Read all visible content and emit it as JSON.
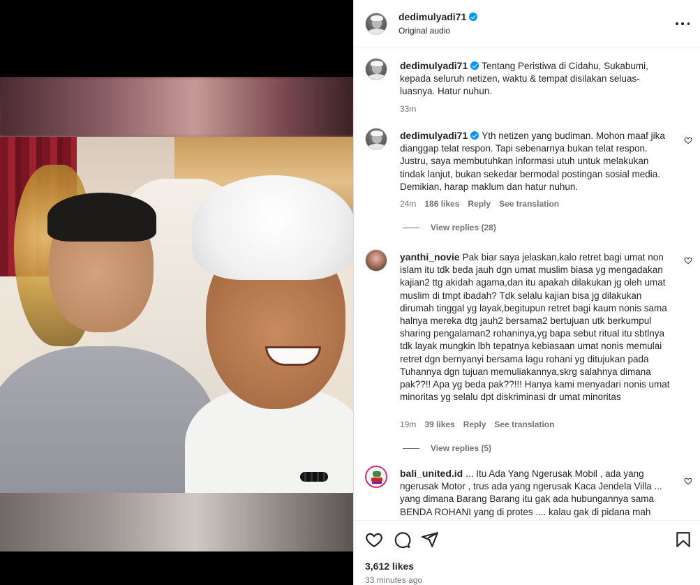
{
  "post": {
    "username": "dedimulyadi71",
    "audio": "Original audio",
    "likes": "3,612 likes",
    "time_ago": "33 minutes ago"
  },
  "comments": [
    {
      "username": "dedimulyadi71",
      "verified": true,
      "text": "Tentang Peristiwa di Cidahu, Sukabumi, kepada seluruh netizen, waktu & tempat disilakan seluas-luasnya. Hatur nuhun.",
      "time": "33m"
    },
    {
      "username": "dedimulyadi71",
      "verified": true,
      "text": "Yth netizen yang budiman. Mohon maaf jika dianggap telat respon. Tapi sebenarnya bukan telat respon. Justru, saya membutuhkan informasi utuh untuk melakukan tindak lanjut, bukan sekedar bermodal postingan sosial media. Demikian, harap maklum dan hatur nuhun.",
      "time": "24m",
      "likes": "186 likes",
      "reply": "Reply",
      "translate": "See translation",
      "view_replies": "View replies (28)"
    },
    {
      "username": "yanthi_novie",
      "verified": false,
      "text": "Pak biar saya jelaskan,kalo retret bagi umat non islam itu tdk beda jauh dgn umat muslim biasa yg mengadakan kajian2 ttg akidah agama,dan itu apakah dilakukan jg oleh umat muslim di tmpt ibadah? Tdk selalu kajian bisa jg dilakukan dirumah tinggal yg layak,begitupun retret bagi kaum nonis sama halnya mereka dtg jauh2 bersama2 bertujuan utk berkumpul sharing pengalaman2 rohaninya,yg bapa sebut ritual itu sbtlnya tdk layak mungkin lbh tepatnya kebiasaan umat nonis memulai retret dgn bernyanyi bersama lagu rohani yg ditujukan pada Tuhannya dgn tujuan memuliakannya,skrg salahnya dimana pak??!! Apa yg beda pak??!!! Hanya kami menyadari nonis umat minoritas yg selalu dpt diskriminasi dr umat minoritas",
      "time": "19m",
      "likes": "39 likes",
      "reply": "Reply",
      "translate": "See translation",
      "view_replies": "View replies (5)"
    },
    {
      "username": "bali_united.id",
      "verified": false,
      "text": "... Itu Ada Yang Ngerusak Mobil , ada yang ngerusak Motor , trus ada yang ngerusak Kaca Jendela Villa ... yang dimana Barang Barang itu gak ada hubungannya sama BENDA ROHANI yang di protes .... kalau gak di pidana mah"
    }
  ],
  "icons": {
    "more": "more-options-icon",
    "like": "heart-icon",
    "comment": "comment-icon",
    "share": "share-icon",
    "save": "bookmark-icon",
    "verified": "verified-badge-icon"
  },
  "colors": {
    "verified": "#0095f6",
    "muted_text": "#737373",
    "text": "#262626",
    "border": "#dbdbdb"
  }
}
